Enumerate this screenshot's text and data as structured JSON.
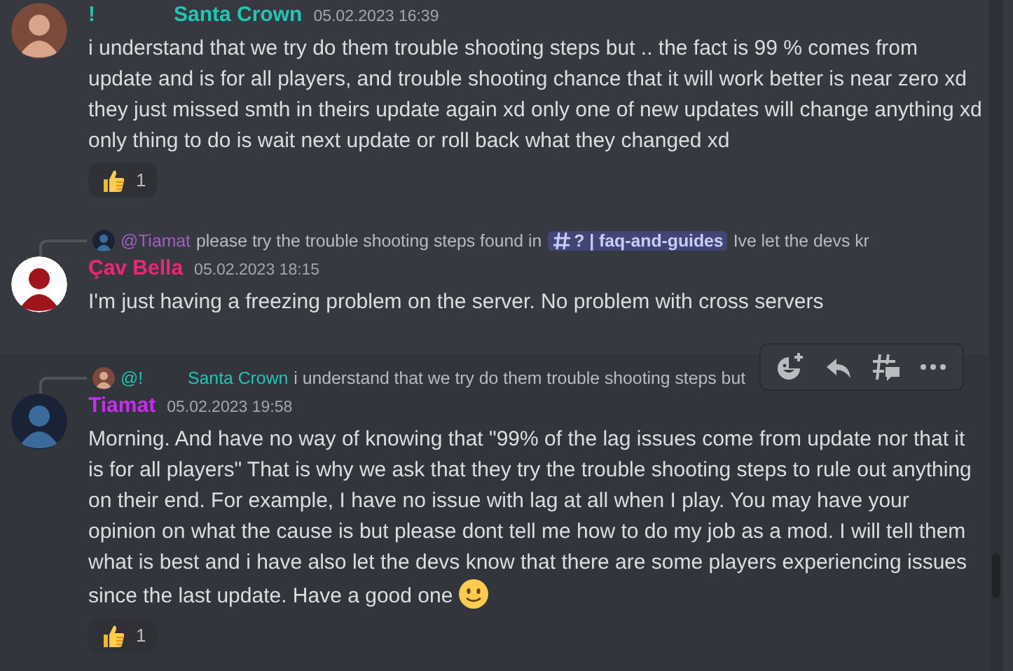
{
  "messages": [
    {
      "author_prefix": "!",
      "author": "Santa Crown",
      "color": "#1fc7b6",
      "timestamp": "05.02.2023 16:39",
      "hovered": false,
      "emoji_end": false,
      "text": "i understand that we try do them trouble shooting steps but .. the fact is 99 % comes from update and is for all players, and trouble shooting chance that it will work better is near zero xd they just missed smth in theirs update again xd only one of new updates will change anything xd only thing to do is wait next update or roll back what they changed xd",
      "reactions": [
        {
          "count": "1"
        }
      ]
    },
    {
      "reply": {
        "mention": "@Tiamat",
        "color": "#a35cc4",
        "text": "please try the trouble shooting steps found in",
        "channel": "? | faq-and-guides",
        "after": "Ive let the devs kr"
      },
      "author": "Çav Bella",
      "color": "#f0257a",
      "timestamp": "05.02.2023 18:15",
      "hovered": false,
      "emoji_end": false,
      "text": "I'm just having a freezing problem on the server. No problem with cross servers"
    },
    {
      "reply": {
        "mention": "@!",
        "color": "#1fc7b6",
        "name": "Santa Crown",
        "text": "i understand that we try do them trouble shooting steps but"
      },
      "author": "Tiamat",
      "color": "#c72ef0",
      "timestamp": "05.02.2023 19:58",
      "hovered": true,
      "emoji_end": true,
      "text": "Morning. And have no way of knowing that \"99% of the lag issues come from update nor that it is for all players\" That is why we ask that they try the trouble shooting steps to rule out anything on their end. For example, I have no issue with lag at all when I play. You may have your opinion on what the cause is but please dont tell me how to do my job as a mod. I will tell them what is best and i have also let the devs know that there are some players experiencing issues since the last update. Have a good one",
      "reactions": [
        {
          "count": "1"
        }
      ]
    }
  ]
}
